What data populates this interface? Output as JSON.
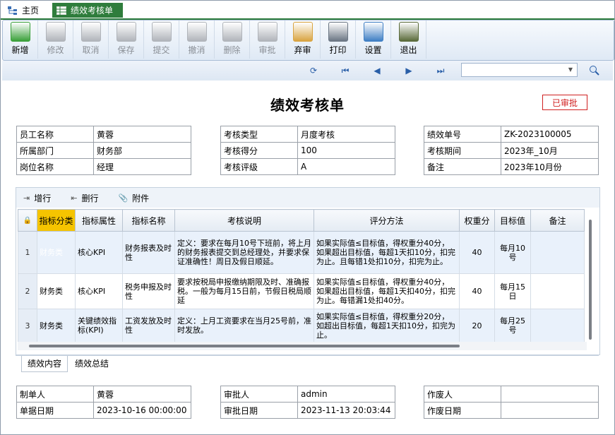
{
  "tabs": {
    "home": "主页",
    "active": "绩效考核单"
  },
  "toolbar": [
    {
      "key": "new",
      "label": "新增",
      "enabled": true,
      "icon": "add-icon"
    },
    {
      "key": "edit",
      "label": "修改",
      "enabled": false,
      "icon": "edit-icon"
    },
    {
      "key": "cancel",
      "label": "取消",
      "enabled": false,
      "icon": "undo-icon"
    },
    {
      "key": "save",
      "label": "保存",
      "enabled": false,
      "icon": "save-icon"
    },
    {
      "key": "submit",
      "label": "提交",
      "enabled": false,
      "icon": "submit-icon"
    },
    {
      "key": "withdraw",
      "label": "撤消",
      "enabled": false,
      "icon": "withdraw-icon"
    },
    {
      "key": "delete",
      "label": "删除",
      "enabled": false,
      "icon": "delete-icon"
    },
    {
      "key": "approve",
      "label": "审批",
      "enabled": false,
      "icon": "approve-icon"
    },
    {
      "key": "abandon",
      "label": "弃审",
      "enabled": true,
      "icon": "abandon-icon"
    },
    {
      "key": "print",
      "label": "打印",
      "enabled": true,
      "icon": "printer-icon"
    },
    {
      "key": "settings",
      "label": "设置",
      "enabled": true,
      "icon": "settings-icon"
    },
    {
      "key": "exit",
      "label": "退出",
      "enabled": true,
      "icon": "exit-icon"
    }
  ],
  "form": {
    "title": "绩效考核单",
    "status": "已审批"
  },
  "info": {
    "employee_label": "员工名称",
    "employee": "黄蓉",
    "dept_label": "所属部门",
    "dept": "财务部",
    "position_label": "岗位名称",
    "position": "经理",
    "type_label": "考核类型",
    "type": "月度考核",
    "score_label": "考核得分",
    "score": "100",
    "grade_label": "考核评级",
    "grade": "A",
    "no_label": "绩效单号",
    "no": "ZK-2023100005",
    "period_label": "考核期间",
    "period": "2023年_10月",
    "remark_label": "备注",
    "remark": "2023年10月份"
  },
  "detail_toolbar": {
    "add_row": "增行",
    "del_row": "删行",
    "attach": "附件"
  },
  "columns": [
    "指标分类",
    "指标属性",
    "指标名称",
    "考核说明",
    "评分方法",
    "权重分",
    "目标值",
    "备注"
  ],
  "rows": [
    {
      "n": "1",
      "category": "财务类",
      "attr": "核心KPI",
      "name": "财务报表及时性",
      "desc": "定义：要求在每月10号下班前，将上月的财务报表提交到总经理处，并要求保证准确性！周日及假日顺延。",
      "method": "如果实际值≤目标值，得权重分40分，如果超出目标值，每超1天扣10分，扣完为止。且每错1处扣10分，扣完为止。",
      "weight": "40",
      "target": "每月10号",
      "note": ""
    },
    {
      "n": "2",
      "category": "财务类",
      "attr": "核心KPI",
      "name": "税务申报及时性",
      "desc": "要求按税局申报缴纳期限及时、准确报税。一般为每月15日前，节假日税局顺延",
      "method": "如果实际值≤目标值，得权重分40分，如果超出目标值，每超1天扣40分，扣完为止。每错漏1处扣40分。",
      "weight": "40",
      "target": "每月15日",
      "note": ""
    },
    {
      "n": "3",
      "category": "财务类",
      "attr": "关键绩效指标(KPI)",
      "name": "工资发放及时性",
      "desc": "定义：上月工资要求在当月25号前，准时发放。",
      "method": "如果实际值≤目标值，得权重分20分，如超出目标值，每超1天扣10分，扣完为止。",
      "weight": "20",
      "target": "每月25号",
      "note": ""
    }
  ],
  "bottom_tabs": [
    "绩效内容",
    "绩效总结"
  ],
  "footer": {
    "maker_label": "制单人",
    "maker": "黄蓉",
    "date_label": "单据日期",
    "date": "2023-10-16 00:00:00",
    "approver_label": "审批人",
    "approver": "admin",
    "approve_date_label": "审批日期",
    "approve_date": "2023-11-13 20:03:44",
    "voider_label": "作废人",
    "voider": "",
    "void_date_label": "作废日期",
    "void_date": ""
  },
  "colors": {
    "accent": "#2f7d3c",
    "selected_cell": "#2f73d1",
    "status_red": "#d02020",
    "selected_header": "#f5c400"
  }
}
